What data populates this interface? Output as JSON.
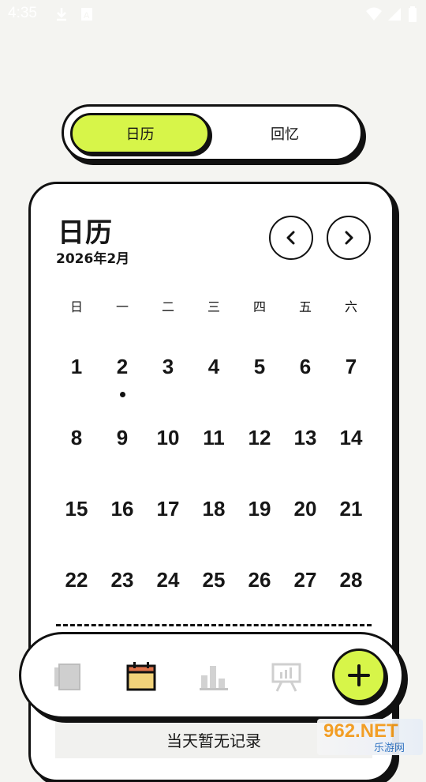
{
  "status_bar": {
    "time": "4:35"
  },
  "toggle": {
    "active_label": "日历",
    "inactive_label": "回忆"
  },
  "calendar": {
    "title": "日历",
    "month_label": "2026年2月",
    "weekdays": [
      "日",
      "一",
      "二",
      "三",
      "四",
      "五",
      "六"
    ],
    "weeks": [
      [
        "1",
        "2",
        "3",
        "4",
        "5",
        "6",
        "7"
      ],
      [
        "8",
        "9",
        "10",
        "11",
        "12",
        "13",
        "14"
      ],
      [
        "15",
        "16",
        "17",
        "18",
        "19",
        "20",
        "21"
      ],
      [
        "22",
        "23",
        "24",
        "25",
        "26",
        "27",
        "28"
      ]
    ],
    "marked_day": "2"
  },
  "empty_notice": "当天暂无记录",
  "bottom_nav": {
    "items": [
      "journal-icon",
      "calendar-icon",
      "stats-icon",
      "presentation-icon"
    ],
    "active": "calendar-icon",
    "accent": "#d7f549"
  },
  "watermark": {
    "brand": "962.NET",
    "sub": "乐游网"
  }
}
